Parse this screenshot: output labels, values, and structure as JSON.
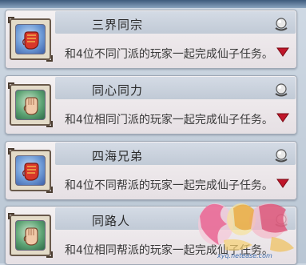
{
  "tasks": [
    {
      "title": "三界同宗",
      "description": "和4位不同门派的玩家一起完成仙子任务。",
      "icon": "red-fist-icon"
    },
    {
      "title": "同心同力",
      "description": "和4位相同门派的玩家一起完成仙子任务。",
      "icon": "open-palm-icon"
    },
    {
      "title": "四海兄弟",
      "description": "和4位不同帮派的玩家一起完成仙子任务。",
      "icon": "red-fist-icon"
    },
    {
      "title": "同路人",
      "description": "和4位相同帮派的玩家一起完成仙子任务。",
      "icon": "open-palm-icon"
    }
  ],
  "watermark": {
    "url": "xyq.netease.com"
  },
  "colors": {
    "arrow": "#c0162a",
    "card": "#f0ecee",
    "header": "#c8d0db"
  }
}
